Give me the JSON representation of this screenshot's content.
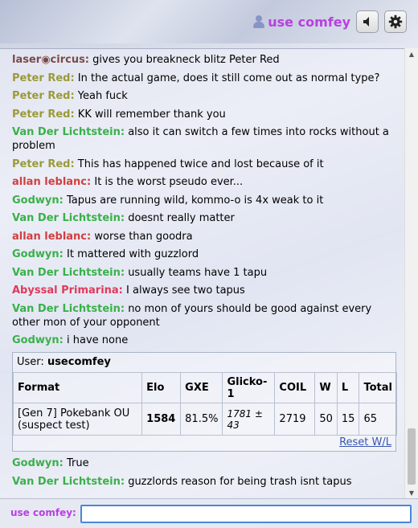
{
  "header": {
    "username": "use comfey"
  },
  "chat": {
    "messages": [
      {
        "user": "laser◉circus:",
        "text": "gives you breakneck blitz Peter Red",
        "cls": "u-laser"
      },
      {
        "user": "Peter Red:",
        "text": "In the actual game, does it still come out as normal type?",
        "cls": "u-peter"
      },
      {
        "user": "Peter Red:",
        "text": "Yeah fuck",
        "cls": "u-peter"
      },
      {
        "user": "Peter Red:",
        "text": "KK will remember thank you",
        "cls": "u-peter"
      },
      {
        "user": "Van Der Lichtstein:",
        "text": "also it can switch a few times into rocks without a problem",
        "cls": "u-van"
      },
      {
        "user": "Peter Red:",
        "text": "This has happened twice and lost because of it",
        "cls": "u-peter"
      },
      {
        "user": "allan leblanc:",
        "text": "It is the worst pseudo ever...",
        "cls": "u-allan"
      },
      {
        "user": "Godwyn:",
        "text": "Tapus are running wild, kommo-o is 4x weak to it",
        "cls": "u-god"
      },
      {
        "user": "Van Der Lichtstein:",
        "text": "doesnt really matter",
        "cls": "u-van"
      },
      {
        "user": "allan leblanc:",
        "text": "worse than goodra",
        "cls": "u-allan"
      },
      {
        "user": "Godwyn:",
        "text": "It mattered with guzzlord",
        "cls": "u-god"
      },
      {
        "user": "Van Der Lichtstein:",
        "text": "usually teams have 1 tapu",
        "cls": "u-van"
      },
      {
        "user": "Abyssal Primarina:",
        "text": "I always see two tapus",
        "cls": "u-aby"
      },
      {
        "user": "Van Der Lichtstein:",
        "text": "no mon of yours should be good against every other mon of your opponent",
        "cls": "u-van"
      },
      {
        "user": "Godwyn:",
        "text": "i have none",
        "cls": "u-god"
      }
    ],
    "after": [
      {
        "user": "Godwyn:",
        "text": "True",
        "cls": "u-god"
      },
      {
        "user": "Van Der Lichtstein:",
        "text": "guzzlords reason for being trash isnt tapus",
        "cls": "u-van"
      }
    ]
  },
  "card": {
    "user_label": "User:",
    "user_value": "usecomfey",
    "headers": [
      "Format",
      "Elo",
      "GXE",
      "Glicko-1",
      "COIL",
      "W",
      "L",
      "Total"
    ],
    "row": {
      "format": "[Gen 7] Pokebank OU (suspect test)",
      "elo": "1584",
      "gxe": "81.5%",
      "glicko": "1781 ± 43",
      "coil": "2719",
      "w": "50",
      "l": "15",
      "total": "65"
    },
    "reset_label": "Reset W/L"
  },
  "input": {
    "label": "use comfey:",
    "value": ""
  }
}
